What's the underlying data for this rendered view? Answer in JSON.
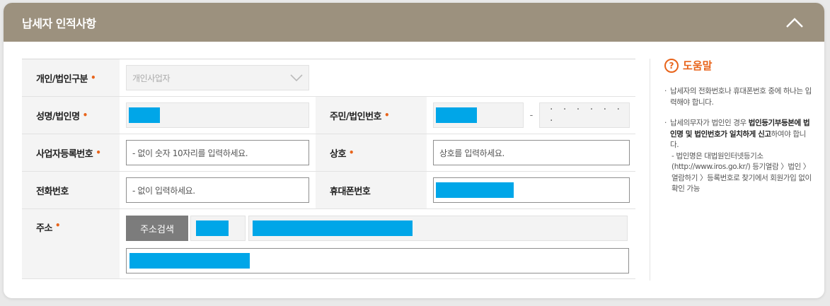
{
  "panel": {
    "title": "납세자 인적사항",
    "header_color": "#9c917e"
  },
  "form": {
    "type_label": "개인/법인구분",
    "type_value": "개인사업자",
    "name_label": "성명/법인명",
    "id_label": "주민/법인번호",
    "id_hyphen": "-",
    "id_masked": "· · · · · · ·",
    "bizno_label": "사업자등록번호",
    "bizno_placeholder": "- 없이 숫자 10자리를 입력하세요.",
    "shop_label": "상호",
    "shop_placeholder": "상호를 입력하세요.",
    "phone_label": "전화번호",
    "phone_placeholder": "- 없이 입력하세요.",
    "mobile_label": "휴대폰번호",
    "address_label": "주소",
    "address_button": "주소검색",
    "required_mark": "•",
    "redaction_color": "#00a6e8",
    "required_color": "#e8641b"
  },
  "help": {
    "title": "도움말",
    "item1": "납세자의 전화번호나 휴대폰번호 중에 하나는 입력해야 합니다.",
    "item2_pre": "납세의무자가 법인인 경우 ",
    "item2_bold": "법인등기부등본에 법인명 및 법인번호가 일치하게 신고",
    "item2_post": "하여야 합니다.",
    "item2_sub": "- 법인명은 대법원인터넷등기소(http://www.iros.go.kr/) 등기열람 〉법인 〉열람하기 〉등록번호로 찾기에서 회원가입 없이 확인 가능"
  }
}
